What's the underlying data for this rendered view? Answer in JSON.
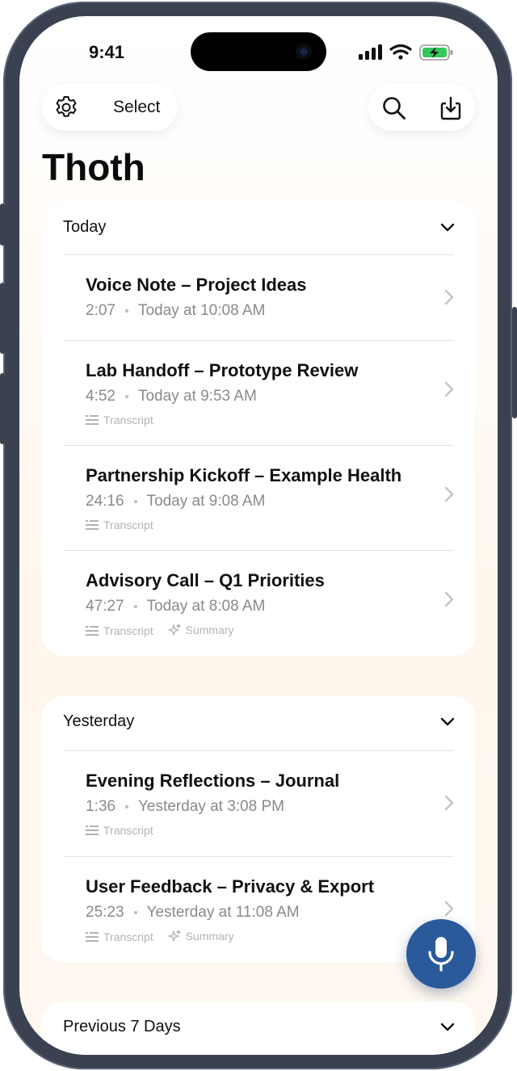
{
  "status_bar": {
    "time": "9:41"
  },
  "toolbar": {
    "settings_icon": "gear-icon",
    "select_label": "Select",
    "search_icon": "search-icon",
    "import_icon": "import-icon"
  },
  "page_title": "Thoth",
  "sections": [
    {
      "label": "Today",
      "items": [
        {
          "title": "Voice Note – Project Ideas",
          "duration": "2:07",
          "date": "Today at 10:08 AM",
          "tags": []
        },
        {
          "title": "Lab Handoff – Prototype Review",
          "duration": "4:52",
          "date": "Today at 9:53 AM",
          "tags": [
            "Transcript"
          ]
        },
        {
          "title": "Partnership Kickoff – Example Health",
          "duration": "24:16",
          "date": "Today at 9:08 AM",
          "tags": [
            "Transcript"
          ]
        },
        {
          "title": "Advisory Call – Q1 Priorities",
          "duration": "47:27",
          "date": "Today at 8:08 AM",
          "tags": [
            "Transcript",
            "Summary"
          ]
        }
      ]
    },
    {
      "label": "Yesterday",
      "items": [
        {
          "title": "Evening Reflections – Journal",
          "duration": "1:36",
          "date": "Yesterday at 3:08 PM",
          "tags": [
            "Transcript"
          ]
        },
        {
          "title": "User Feedback – Privacy & Export",
          "duration": "25:23",
          "date": "Yesterday at 11:08 AM",
          "tags": [
            "Transcript",
            "Summary"
          ]
        }
      ]
    },
    {
      "label": "Previous 7 Days",
      "items": []
    }
  ],
  "record_button_icon": "microphone-icon",
  "colors": {
    "accent": "#2b5a9a",
    "battery": "#34c759"
  }
}
